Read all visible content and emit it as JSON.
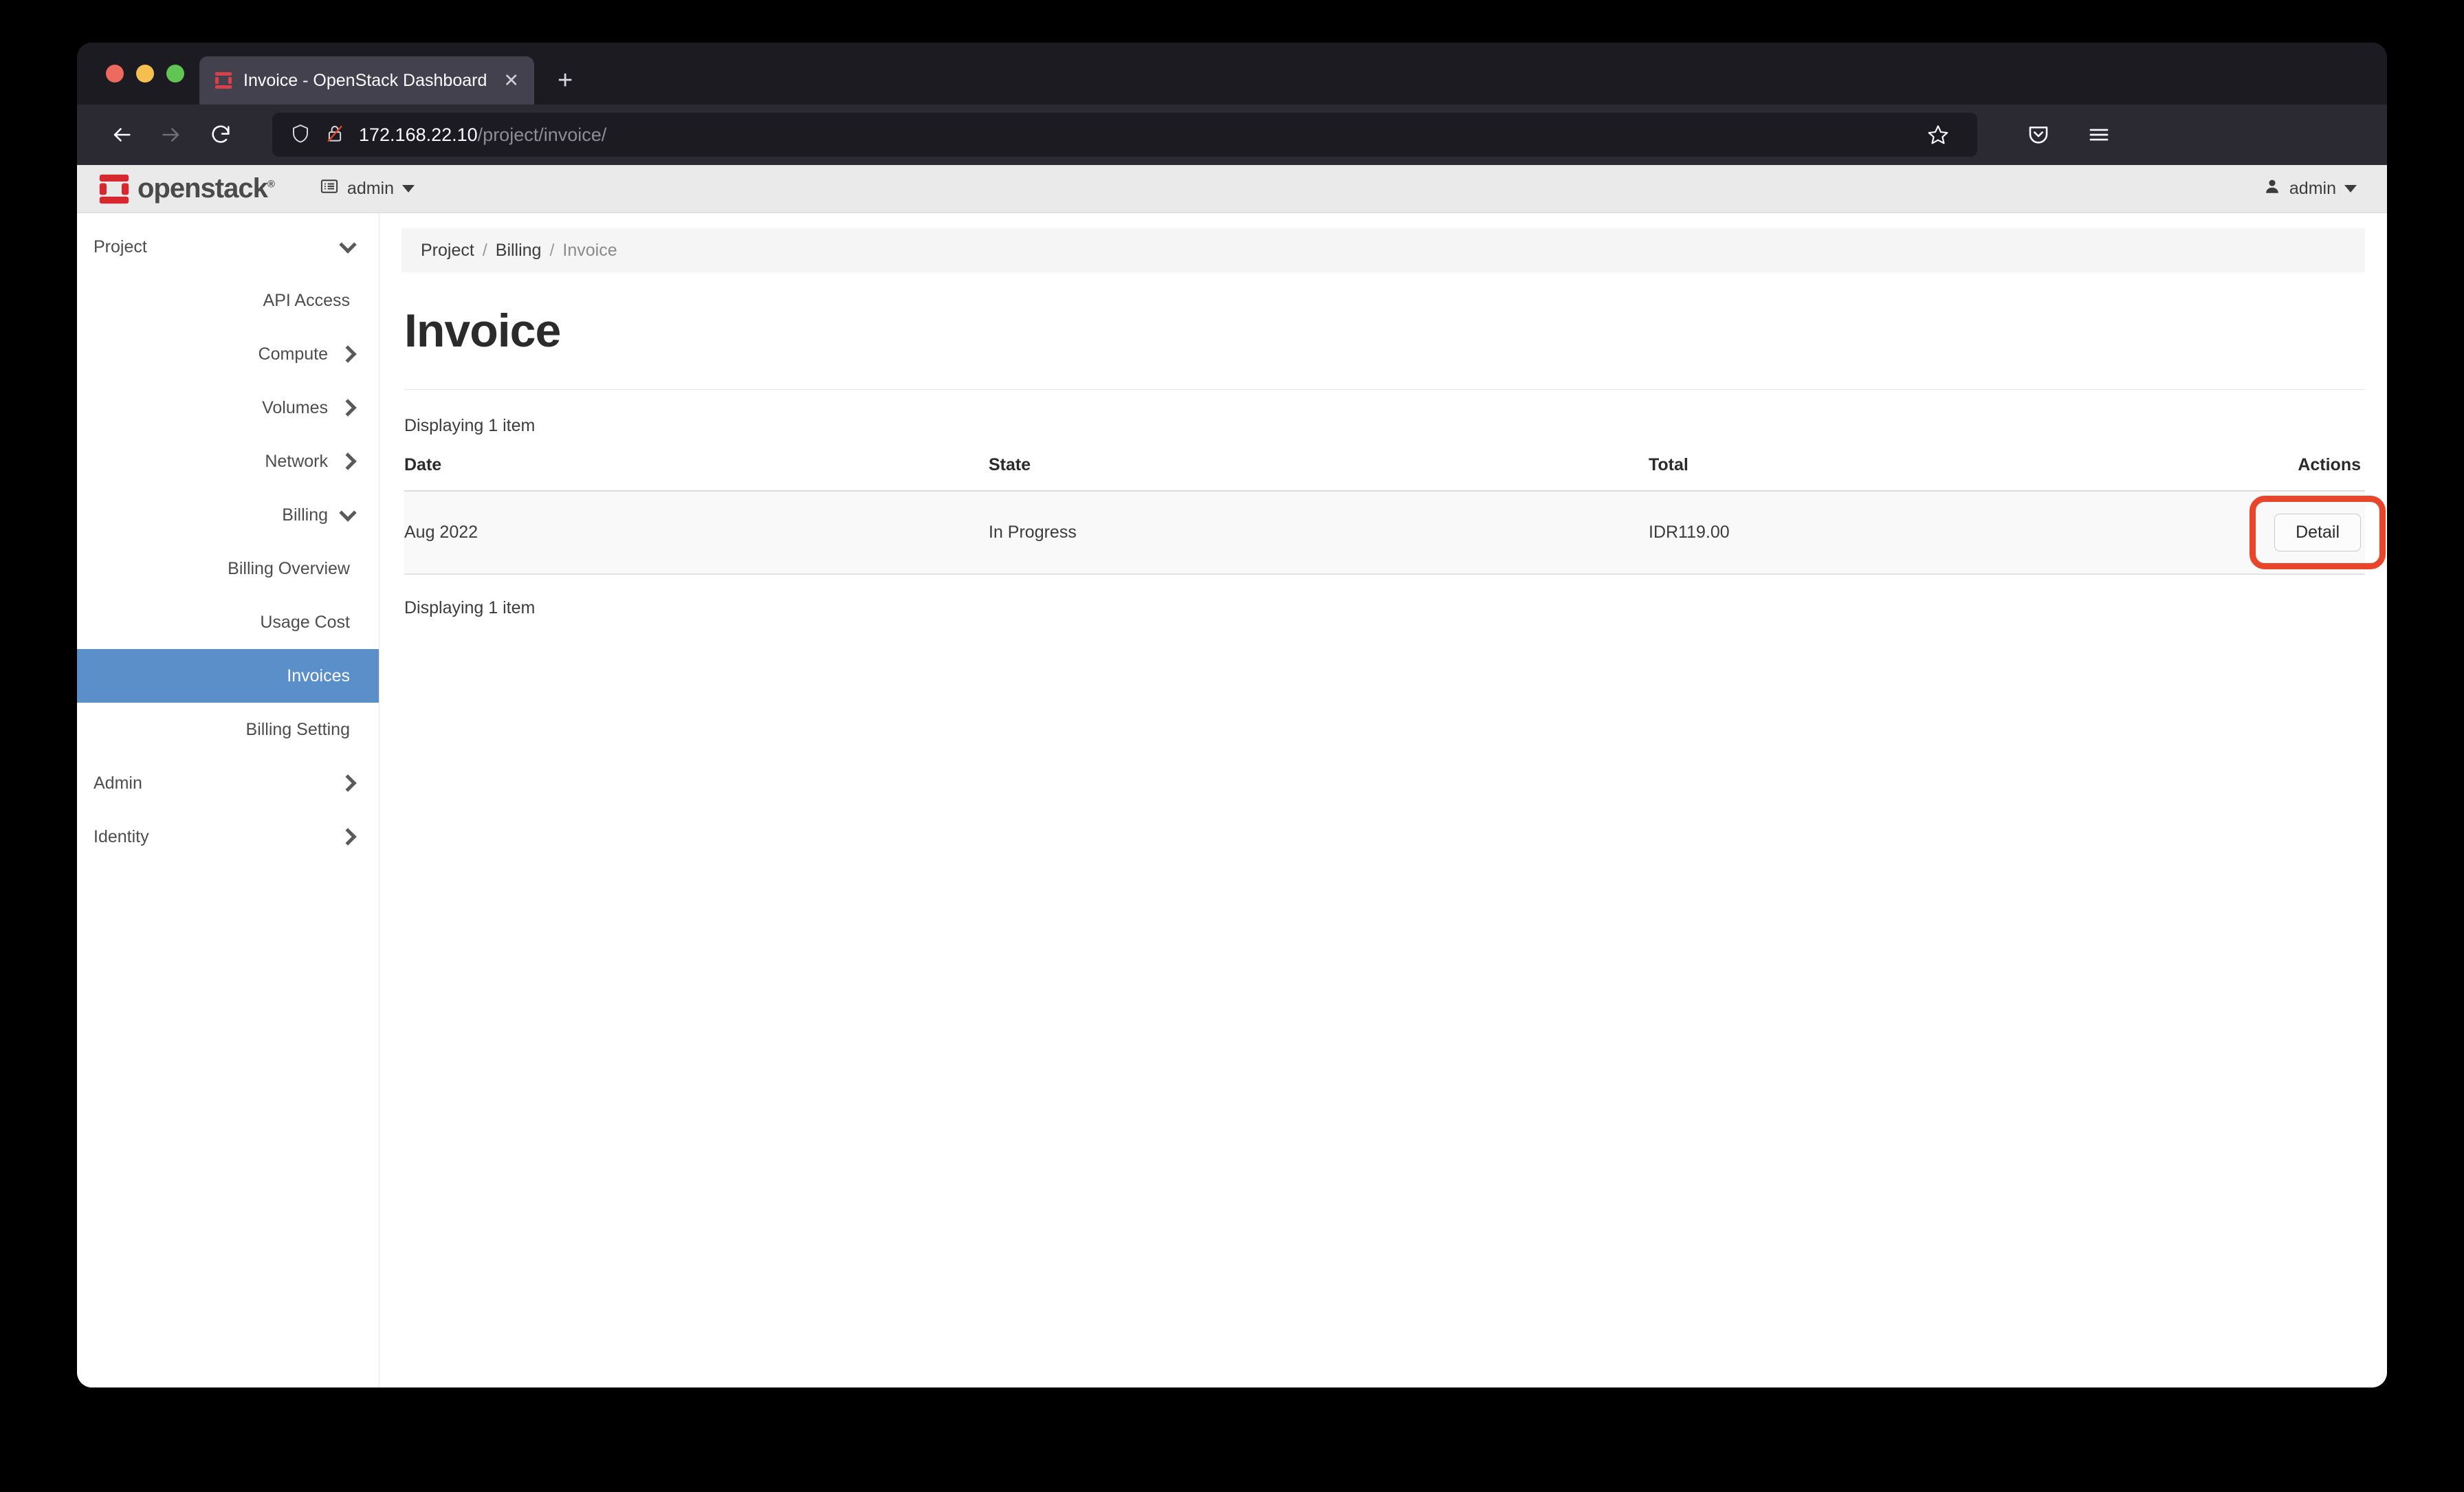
{
  "browser": {
    "tab": {
      "title": "Invoice - OpenStack Dashboard",
      "favicon_name": "openstack-favicon",
      "close_label": "✕"
    },
    "new_tab_label": "+",
    "nav": {
      "back_label": "←",
      "forward_label": "→",
      "reload_label": "↻"
    },
    "url": {
      "host": "172.168.22.10",
      "path": "/project/invoice/",
      "shield_icon": "shield-icon",
      "security_icon": "lock-crossed-icon"
    },
    "actions": {
      "bookmark_icon": "star-icon",
      "pocket_icon": "pocket-icon",
      "menu_icon": "hamburger-menu-icon"
    }
  },
  "header": {
    "brand": "openstack",
    "brand_mark": "openstack-logo-icon",
    "trademark": "®",
    "project_selector": {
      "icon": "project-list-icon",
      "label": "admin"
    },
    "user_menu": {
      "icon": "user-icon",
      "label": "admin"
    }
  },
  "sidebar": {
    "items": [
      {
        "label": "Project",
        "type": "top",
        "chevron": "down",
        "active": false
      },
      {
        "label": "API Access",
        "type": "sub",
        "chevron": "none",
        "active": false
      },
      {
        "label": "Compute",
        "type": "sub",
        "chevron": "right",
        "active": false
      },
      {
        "label": "Volumes",
        "type": "sub",
        "chevron": "right",
        "active": false
      },
      {
        "label": "Network",
        "type": "sub",
        "chevron": "right",
        "active": false
      },
      {
        "label": "Billing",
        "type": "sub",
        "chevron": "down",
        "active": false
      },
      {
        "label": "Billing Overview",
        "type": "sub2",
        "chevron": "none",
        "active": false
      },
      {
        "label": "Usage Cost",
        "type": "sub2",
        "chevron": "none",
        "active": false
      },
      {
        "label": "Invoices",
        "type": "sub2",
        "chevron": "none",
        "active": true
      },
      {
        "label": "Billing Setting",
        "type": "sub2",
        "chevron": "none",
        "active": false
      },
      {
        "label": "Admin",
        "type": "top",
        "chevron": "right",
        "active": false
      },
      {
        "label": "Identity",
        "type": "top",
        "chevron": "right",
        "active": false
      }
    ]
  },
  "main": {
    "breadcrumb": [
      {
        "label": "Project",
        "last": false
      },
      {
        "label": "Billing",
        "last": false
      },
      {
        "label": "Invoice",
        "last": true
      }
    ],
    "breadcrumb_separator": "/",
    "page_title": "Invoice",
    "count_top": "Displaying 1 item",
    "count_bottom": "Displaying 1 item",
    "table": {
      "columns": [
        "Date",
        "State",
        "Total",
        "Actions"
      ],
      "rows": [
        {
          "date": "Aug 2022",
          "state": "In Progress",
          "total": "IDR119.00",
          "action_label": "Detail"
        }
      ]
    }
  },
  "annotation": {
    "color": "#e8452a",
    "target": "detail-button"
  },
  "colors": {
    "accent_active": "#5b8fc9",
    "brand_red": "#d8282f",
    "annotation_red": "#e8452a",
    "header_bg": "#eaeaea",
    "row_bg": "#f9f9f9"
  }
}
